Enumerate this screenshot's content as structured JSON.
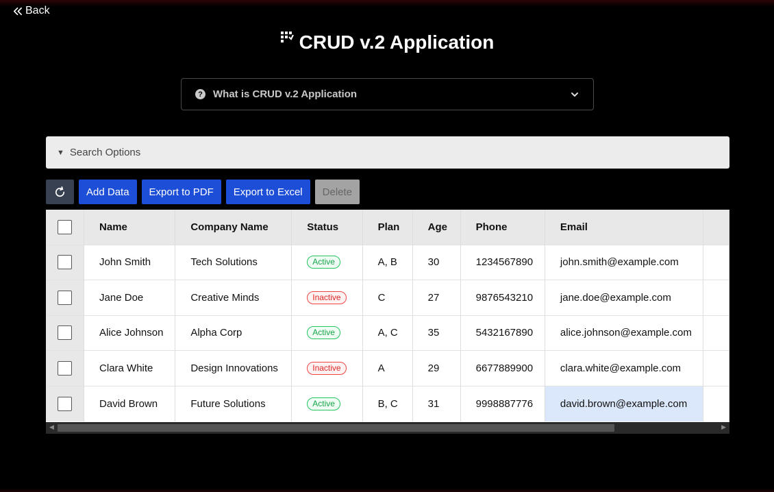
{
  "nav": {
    "back_label": "Back"
  },
  "header": {
    "title": "CRUD v.2 Application"
  },
  "accordion": {
    "label": "What is CRUD v.2 Application"
  },
  "search": {
    "label": "Search Options"
  },
  "toolbar": {
    "add_label": "Add Data",
    "pdf_label": "Export to PDF",
    "excel_label": "Export to Excel",
    "delete_label": "Delete"
  },
  "table": {
    "columns": [
      "Name",
      "Company Name",
      "Status",
      "Plan",
      "Age",
      "Phone",
      "Email"
    ],
    "rows": [
      {
        "name": "John Smith",
        "company": "Tech Solutions",
        "status": "Active",
        "plan": "A, B",
        "age": "30",
        "phone": "1234567890",
        "email": "john.smith@example.com"
      },
      {
        "name": "Jane Doe",
        "company": "Creative Minds",
        "status": "Inactive",
        "plan": "C",
        "age": "27",
        "phone": "9876543210",
        "email": "jane.doe@example.com"
      },
      {
        "name": "Alice Johnson",
        "company": "Alpha Corp",
        "status": "Active",
        "plan": "A, C",
        "age": "35",
        "phone": "5432167890",
        "email": "alice.johnson@example.com"
      },
      {
        "name": "Clara White",
        "company": "Design Innovations",
        "status": "Inactive",
        "plan": "A",
        "age": "29",
        "phone": "6677889900",
        "email": "clara.white@example.com"
      },
      {
        "name": "David Brown",
        "company": "Future Solutions",
        "status": "Active",
        "plan": "B, C",
        "age": "31",
        "phone": "9998887776",
        "email": "david.brown@example.com"
      }
    ]
  },
  "colors": {
    "primary_button": "#1d4ed8",
    "refresh_button": "#374151",
    "active_badge": "#16a34a",
    "inactive_badge": "#dc2626",
    "selected_cell": "#dbe8fb"
  },
  "icons": {
    "back": "double-chevron-left-icon",
    "logo": "grid-logo-icon",
    "accordion": "question-circle-icon",
    "refresh": "refresh-icon"
  }
}
